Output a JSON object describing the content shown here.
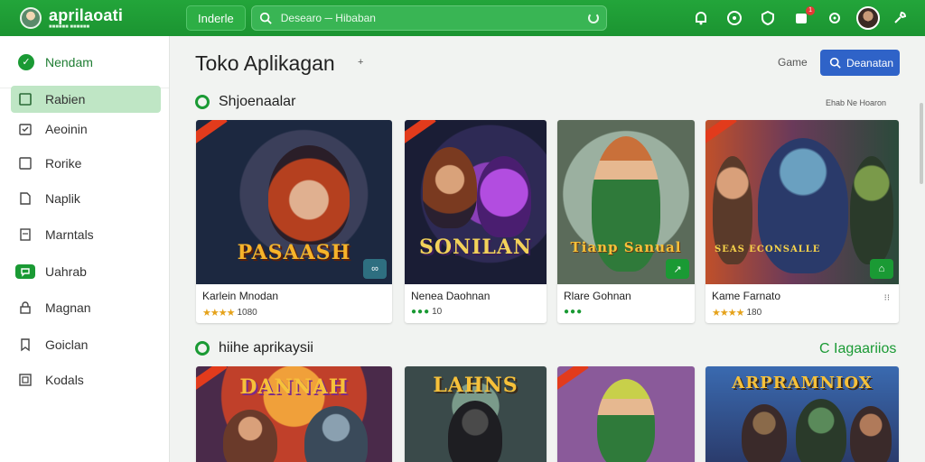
{
  "topbar": {
    "logo_title": "aprilaoati",
    "logo_subtitle": "■■■■■■ ■■■■■■",
    "tab_label": "Inderle",
    "search_placeholder": "Desearo ─ Hibaban",
    "notification_count": "1"
  },
  "sidebar": {
    "header_label": "Nendam",
    "items": [
      {
        "label": "Rabien",
        "icon": "square-icon",
        "active": true
      },
      {
        "label": "Aeoinin",
        "icon": "calendar-icon",
        "active": false
      },
      {
        "label": "Rorike",
        "icon": "square-icon",
        "active": false
      },
      {
        "label": "Naplik",
        "icon": "document-icon",
        "active": false
      },
      {
        "label": "Marntals",
        "icon": "note-icon",
        "active": false
      },
      {
        "label": "Uahrab",
        "icon": "chat-icon",
        "active": false
      },
      {
        "label": "Magnan",
        "icon": "lock-icon",
        "active": false
      },
      {
        "label": "Goiclan",
        "icon": "bookmark-icon",
        "active": false
      },
      {
        "label": "Kodals",
        "icon": "box-icon",
        "active": false
      }
    ]
  },
  "main": {
    "title": "Toko Aplikagan",
    "title_mark": "+",
    "game_link": "Game",
    "search_button": "Deanatan",
    "section1": {
      "title": "Shjoenaalar",
      "see_more": "Ehab  Ne  Hoaron",
      "cards": [
        {
          "art_title": "PASAASH",
          "name": "Karlein Mnodan",
          "rating_style": "stars",
          "rating_symbols": "★★★★",
          "rating": "1080",
          "option": "",
          "corner": "∞"
        },
        {
          "art_title": "SONILAN",
          "name": "Nenea Daohnan",
          "rating_style": "dots",
          "rating_symbols": "●●●",
          "rating": "10",
          "option": "",
          "corner": ""
        },
        {
          "art_title": "Tianp Sanual",
          "name": "Rlare Gohnan",
          "rating_style": "dots",
          "rating_symbols": "●●●",
          "rating": "",
          "option": "",
          "corner": "↗"
        },
        {
          "art_title": "SEAS ECONSALLE",
          "name": "Kame Farnato",
          "rating_style": "stars",
          "rating_symbols": "★★★★",
          "rating": "180",
          "option": "⁝⁝",
          "corner": "⌂"
        }
      ]
    },
    "section2": {
      "title": "hiihe aprikaysii",
      "see_more": "C Iagaariios",
      "cards": [
        {
          "art_title": "DANNAH"
        },
        {
          "art_title": "LAHNS"
        },
        {
          "art_title": ""
        },
        {
          "art_title": "ARPRAMNIOX"
        }
      ]
    }
  },
  "colors": {
    "brand_green": "#1b9431",
    "accent_blue": "#2f63c8",
    "active_bg": "#bfe6c5"
  }
}
